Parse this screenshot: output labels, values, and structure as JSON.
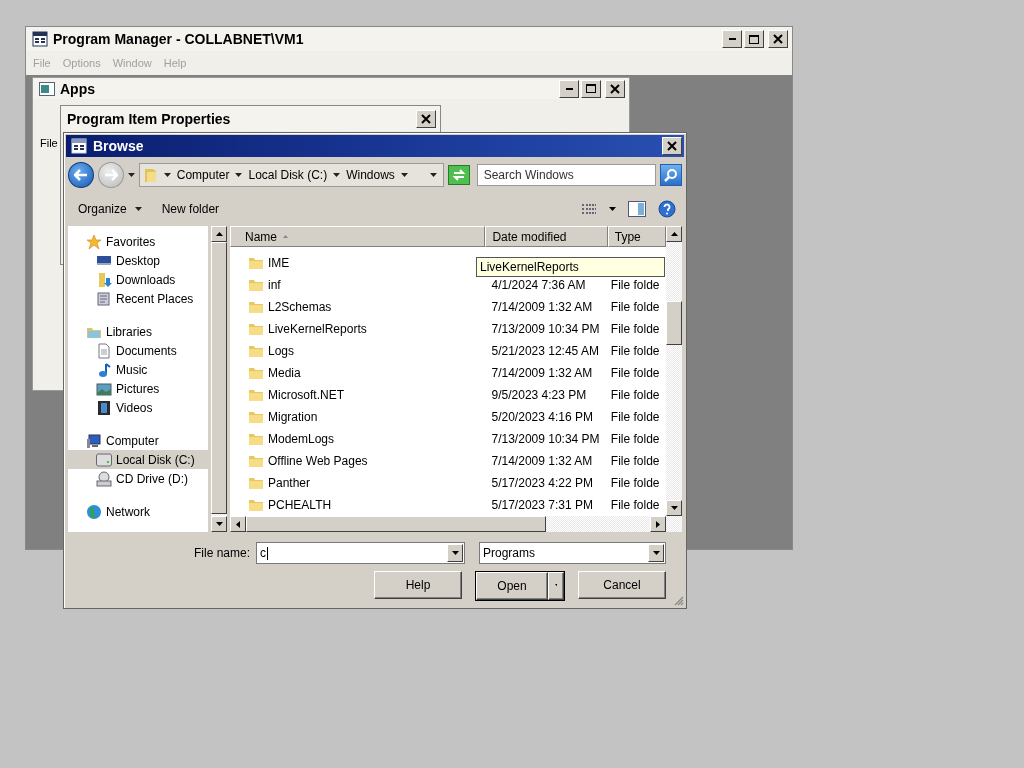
{
  "program_manager": {
    "title": "Program Manager - COLLABNET\\VM1",
    "menu": [
      {
        "label": "File",
        "disabled": true
      },
      {
        "label": "Options",
        "disabled": true
      },
      {
        "label": "Window",
        "disabled": true
      },
      {
        "label": "Help",
        "disabled": true
      }
    ]
  },
  "apps_window": {
    "title": "Apps",
    "label": "File"
  },
  "properties_dialog": {
    "title": "Program Item Properties"
  },
  "browse_dialog": {
    "title": "Browse",
    "breadcrumb": [
      "Computer",
      "Local Disk (C:)",
      "Windows"
    ],
    "search": {
      "placeholder": "Search Windows"
    },
    "toolbar": [
      "Organize",
      "New folder"
    ],
    "nav": [
      {
        "label": "Favorites",
        "selected": false,
        "children": [
          {
            "label": "Desktop",
            "selected": false
          },
          {
            "label": "Downloads",
            "selected": false
          },
          {
            "label": "Recent Places",
            "selected": false
          }
        ]
      },
      {
        "label": "Libraries",
        "selected": false,
        "children": [
          {
            "label": "Documents",
            "selected": false
          },
          {
            "label": "Music",
            "selected": false
          },
          {
            "label": "Pictures",
            "selected": false
          },
          {
            "label": "Videos",
            "selected": false
          }
        ]
      },
      {
        "label": "Computer",
        "selected": false,
        "children": [
          {
            "label": "Local Disk (C:)",
            "selected": true
          },
          {
            "label": "CD Drive (D:)",
            "selected": false
          }
        ]
      },
      {
        "label": "Network",
        "selected": false
      }
    ],
    "columns": [
      "Name",
      "Date modified",
      "Type"
    ],
    "rows": [
      {
        "name": "IME"
      },
      {
        "name": "inf",
        "date": "4/1/2024 7:36 AM",
        "type": "File folde"
      },
      {
        "name": "L2Schemas",
        "date": "7/14/2009 1:32 AM",
        "type": "File folde"
      },
      {
        "name": "LiveKernelReports",
        "date": "7/13/2009 10:34 PM",
        "type": "File folde"
      },
      {
        "name": "Logs",
        "date": "5/21/2023 12:45 AM",
        "type": "File folde"
      },
      {
        "name": "Media",
        "date": "7/14/2009 1:32 AM",
        "type": "File folde"
      },
      {
        "name": "Microsoft.NET",
        "date": "9/5/2023 4:23 PM",
        "type": "File folde"
      },
      {
        "name": "Migration",
        "date": "5/20/2023 4:16 PM",
        "type": "File folde"
      },
      {
        "name": "ModemLogs",
        "date": "7/13/2009 10:34 PM",
        "type": "File folde"
      },
      {
        "name": "Offline Web Pages",
        "date": "7/14/2009 1:32 AM",
        "type": "File folde"
      },
      {
        "name": "Panther",
        "date": "5/17/2023 4:22 PM",
        "type": "File folde"
      },
      {
        "name": "PCHEALTH",
        "date": "5/17/2023 7:31 PM",
        "type": "File folde"
      }
    ],
    "tooltip": "LiveKernelReports",
    "file_name_label": "File name:",
    "file_name": "c",
    "file_type": "Programs",
    "buttons": [
      "Help",
      "Open",
      "Cancel"
    ]
  }
}
